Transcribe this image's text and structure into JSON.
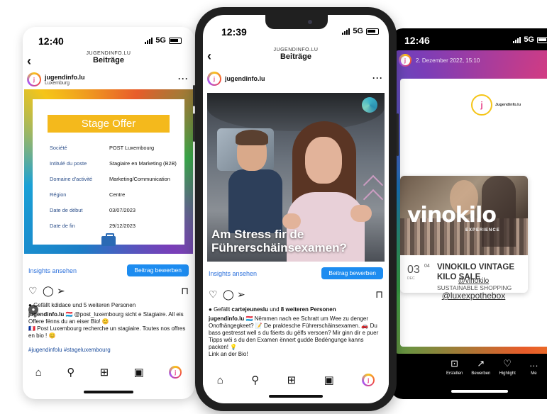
{
  "left": {
    "time": "12:40",
    "network": "5G",
    "nav_small": "JUGENDINFO.LU",
    "nav_title": "Beiträge",
    "account_name": "jugendinfo.lu",
    "account_location": "Luxemburg",
    "card": {
      "banner": "Stage Offer",
      "rows": [
        {
          "k": "Société",
          "v": "POST Luxembourg"
        },
        {
          "k": "Intitulé du poste",
          "v": "Stagiaire en Marketing (B2B)"
        },
        {
          "k": "Domaine d'activité",
          "v": "Marketing/Communication"
        },
        {
          "k": "Région",
          "v": "Centre"
        },
        {
          "k": "Date de début",
          "v": "03/07/2023"
        },
        {
          "k": "Date de fin",
          "v": "29/12/2023"
        }
      ]
    },
    "insights": "Insights ansehen",
    "boost": "Beitrag bewerben",
    "likes": "Gefällt kdidace und 5 weiteren Personen",
    "caption_user": "jugendinfo.lu",
    "caption_line1": "🇱🇺 @post_luxembourg sicht e Stagiaire. All eis Offere fënns du an eiser Bio! 😊",
    "caption_line2": "🇫🇷 Post Luxembourg recherche un stagiaire. Toutes nos offres en bio ! 😊",
    "hashtags": "#jugendinfolu #stageluxembourg"
  },
  "mid": {
    "time": "12:39",
    "network": "5G",
    "nav_small": "JUGENDINFO.LU",
    "nav_title": "Beiträge",
    "account_name": "jugendinfo.lu",
    "photo_title": "Am Stress fir de Führerschäinsexamen?",
    "insights": "Insights ansehen",
    "boost": "Beitrag bewerben",
    "likes_pre": "Gefällt",
    "likes_user": "cartejeuneslu",
    "likes_post": "und 8 weiteren Personen",
    "caption_user": "jugendinfo.lu",
    "caption": "🇱🇺 Nëmmen nach ee Schratt um Wee zu denger Onofhängegkeet? 📝 De praktesche Führerschäinsexamen. 🚗 Du bass gestresst well s du fäerts du gëlfs versoen? Mir ginn dir e puer Tipps wéi s du den Examen ënnert gudde Bedéngunge kanns packen! 💡",
    "caption_tail": "Link an der Bio!"
  },
  "right": {
    "time": "12:46",
    "network": "5G",
    "story_date": "2. Dezember 2022, 15:10",
    "logo_text": "Jugendinfo.lu",
    "vino_word": "vinokilo",
    "vino_exp": "EXPERIENCE",
    "date_day": "03",
    "date_day2": "04",
    "date_month": "DEC",
    "event_title": "VINOKILO VINTAGE KILO SALE",
    "event_sub": "SUSTAINABLE SHOPPING",
    "handle1": "@vinokilo",
    "handle2": "@luxexpothebox",
    "tabs": [
      {
        "icon": "⊡",
        "label": "Erstellen"
      },
      {
        "icon": "↗",
        "label": "Bewerben"
      },
      {
        "icon": "♡",
        "label": "Highlight"
      },
      {
        "icon": "…",
        "label": "Me"
      }
    ]
  },
  "colors": {
    "accent_blue": "#1d8cf0",
    "banner_yellow": "#f4b91c",
    "link_blue": "#2a6fdb"
  }
}
